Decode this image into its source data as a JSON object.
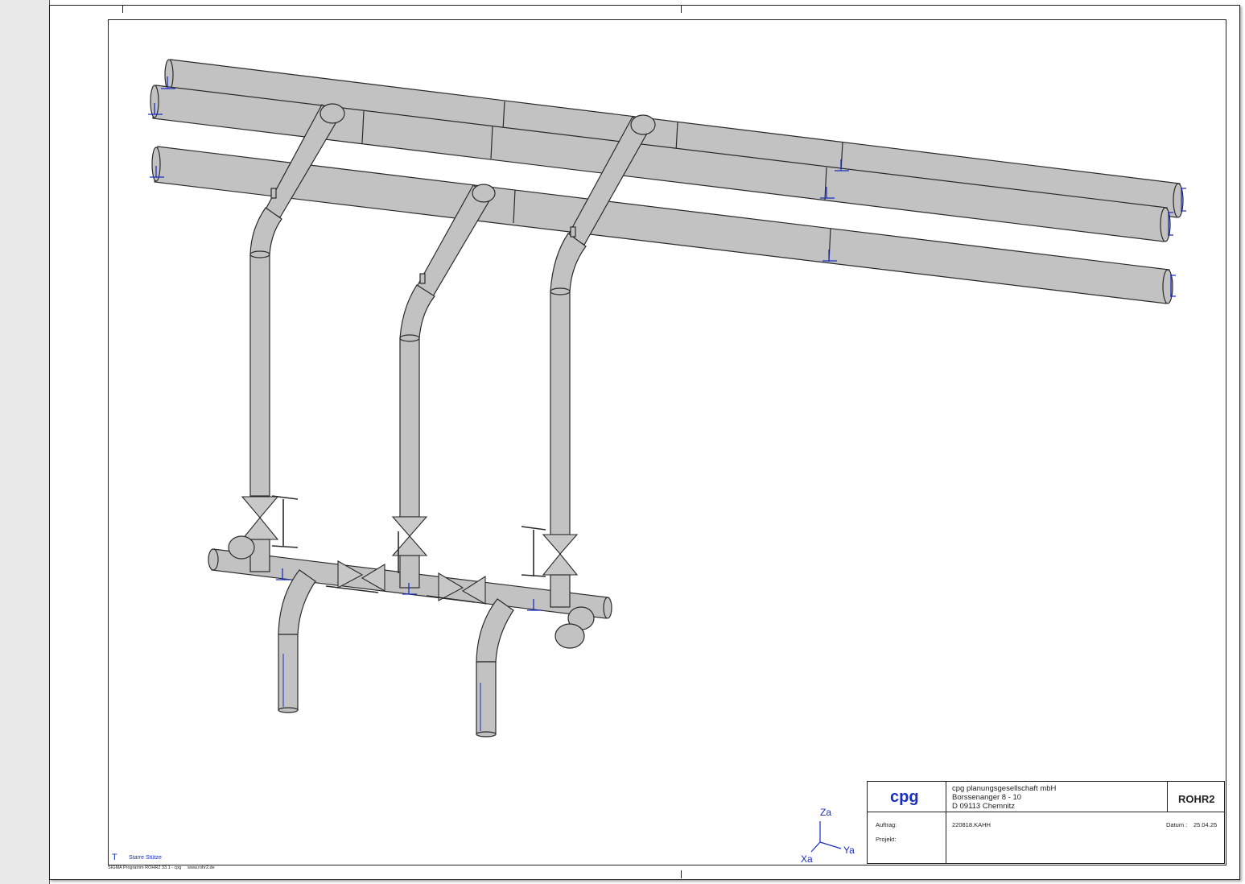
{
  "company": {
    "logo": "cpg",
    "name": "cpg planungsgesellschaft mbH",
    "street": "Borssenanger 8 - 10",
    "city": "D 09113 Chemnitz"
  },
  "program_badge": "ROHR2",
  "fields": {
    "auftrag_label": "Auftrag:",
    "auftrag_value": "220818.KAHH",
    "datum_label": "Datum :",
    "datum_value": "25.04.25",
    "projekt_label": "Projekt:"
  },
  "legend": {
    "symbol": "T",
    "label": "Starre Stütze"
  },
  "footer": {
    "program": "SIGMA Programm ROHR2 33.1 - cpg",
    "website": "www.rohr2.de"
  },
  "axes": {
    "z": "Za",
    "x": "Xa",
    "y": "Ya"
  },
  "colors": {
    "pipe_fill": "#c0c0c0",
    "pipe_stroke": "#2a2a2a",
    "support_blue": "#1a2fbf",
    "frame": "#222222"
  }
}
